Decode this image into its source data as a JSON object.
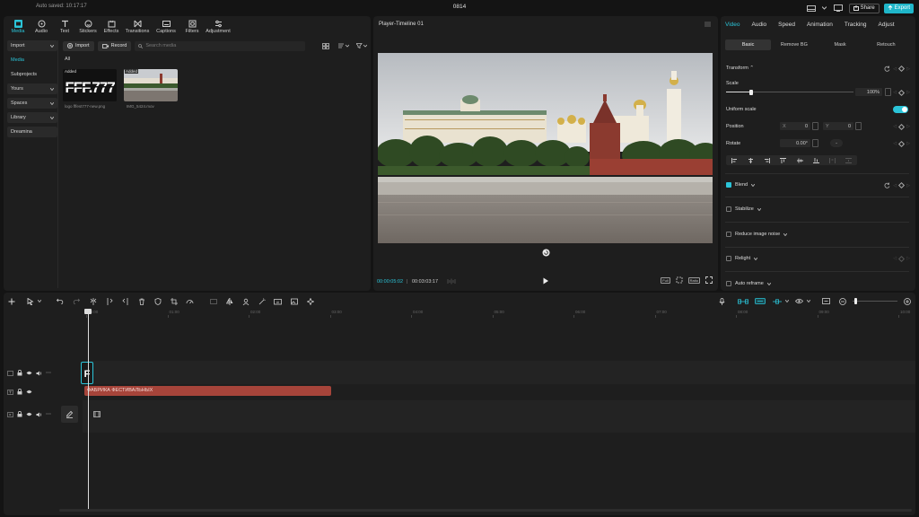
{
  "topbar": {
    "autosaved": "Auto saved: 10:17:17",
    "project_title": "0814",
    "share_label": "Share",
    "export_label": "Export",
    "icons": [
      "layout-icon",
      "monitor-icon",
      "keyboard-icon"
    ]
  },
  "media_panel": {
    "tabs": [
      {
        "label": "Media",
        "icon": "media-icon",
        "active": true
      },
      {
        "label": "Audio",
        "icon": "audio-icon"
      },
      {
        "label": "Text",
        "icon": "text-icon"
      },
      {
        "label": "Stickers",
        "icon": "stickers-icon"
      },
      {
        "label": "Effects",
        "icon": "effects-icon"
      },
      {
        "label": "Transitions",
        "icon": "transitions-icon"
      },
      {
        "label": "Captions",
        "icon": "captions-icon"
      },
      {
        "label": "Filters",
        "icon": "filters-icon"
      },
      {
        "label": "Adjustment",
        "icon": "adjustment-icon"
      }
    ],
    "sidebar": [
      {
        "label": "Import",
        "dropdown": true
      },
      {
        "label": "Media"
      },
      {
        "label": "Subprojects"
      },
      {
        "label": "Yours",
        "dropdown": true
      },
      {
        "label": "Spaces",
        "dropdown": true
      },
      {
        "label": "Library",
        "dropdown": true
      },
      {
        "label": "Dreamina"
      }
    ],
    "import_button": "Import",
    "record_button": "Record",
    "search_placeholder": "Search media",
    "filter_all": "All",
    "items": [
      {
        "name": "logo fffest777-new.png",
        "badge": "Added"
      },
      {
        "name": "IMG_5424.mov",
        "badge": "Added"
      }
    ]
  },
  "player": {
    "title": "Player-Timeline 01",
    "current_time": "00:00:05:02",
    "separator": "|",
    "total_time": "00:03:03:17",
    "full_label": "Full",
    "ratio_label": "Ratio"
  },
  "properties": {
    "tabs": [
      {
        "label": "Video",
        "active": true
      },
      {
        "label": "Audio"
      },
      {
        "label": "Speed"
      },
      {
        "label": "Animation"
      },
      {
        "label": "Tracking"
      },
      {
        "label": "Adjust"
      }
    ],
    "sub_tabs": [
      {
        "label": "Basic",
        "active": true
      },
      {
        "label": "Remove BG"
      },
      {
        "label": "Mask"
      },
      {
        "label": "Retouch"
      }
    ],
    "transform_label": "Transform",
    "scale_label": "Scale",
    "scale_value": "100%",
    "scale_fraction": 0.2,
    "uniform_scale_label": "Uniform scale",
    "uniform_scale_on": true,
    "position_label": "Position",
    "pos_x_label": "X",
    "pos_x_value": "0",
    "pos_y_label": "Y",
    "pos_y_value": "0",
    "rotate_label": "Rotate",
    "rotate_value": "0.00°",
    "rotate_reset": "-",
    "blend_label": "Blend",
    "blend_on": true,
    "stabilize_label": "Stabilize",
    "reduce_noise_label": "Reduce image noise",
    "relight_label": "Relight",
    "auto_reframe_label": "Auto reframe"
  },
  "timeline": {
    "ruler_labels": [
      "00:00",
      "01:00",
      "02:00",
      "03:00",
      "04:00",
      "05:00",
      "06:00",
      "07:00",
      "08:00",
      "09:00",
      "10:00"
    ],
    "text_clip_label": "ФАБРИКА ФЕСТИВАЛЬНЫХ",
    "colors": {
      "accent": "#2bc4d8",
      "text_clip": "#a6443a"
    }
  }
}
